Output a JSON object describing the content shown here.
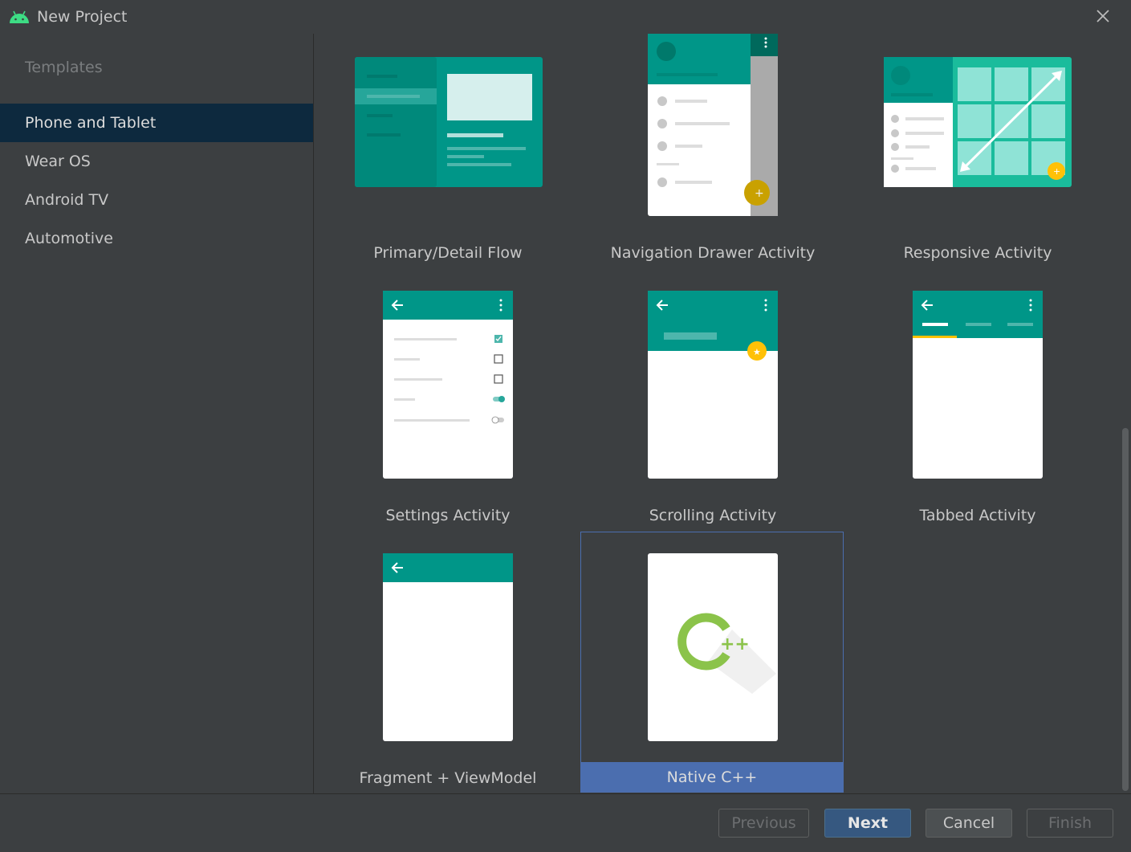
{
  "window": {
    "title": "New Project",
    "close_icon": "close-icon",
    "app_icon": "android-icon"
  },
  "sidebar": {
    "heading": "Templates",
    "items": [
      {
        "label": "Phone and Tablet",
        "selected": true
      },
      {
        "label": "Wear OS",
        "selected": false
      },
      {
        "label": "Android TV",
        "selected": false
      },
      {
        "label": "Automotive",
        "selected": false
      }
    ]
  },
  "templates": [
    {
      "label": "Primary/Detail Flow"
    },
    {
      "label": "Navigation Drawer Activity"
    },
    {
      "label": "Responsive Activity"
    },
    {
      "label": "Settings Activity"
    },
    {
      "label": "Scrolling Activity"
    },
    {
      "label": "Tabbed Activity"
    },
    {
      "label": "Fragment + ViewModel"
    },
    {
      "label": "Native C++",
      "selected": true
    }
  ],
  "buttons": {
    "previous": "Previous",
    "next": "Next",
    "cancel": "Cancel",
    "finish": "Finish"
  },
  "colors": {
    "teal": "#009688",
    "teal_dark": "#00796b",
    "selection": "#4b6eaf",
    "accent": "#ffc107"
  }
}
